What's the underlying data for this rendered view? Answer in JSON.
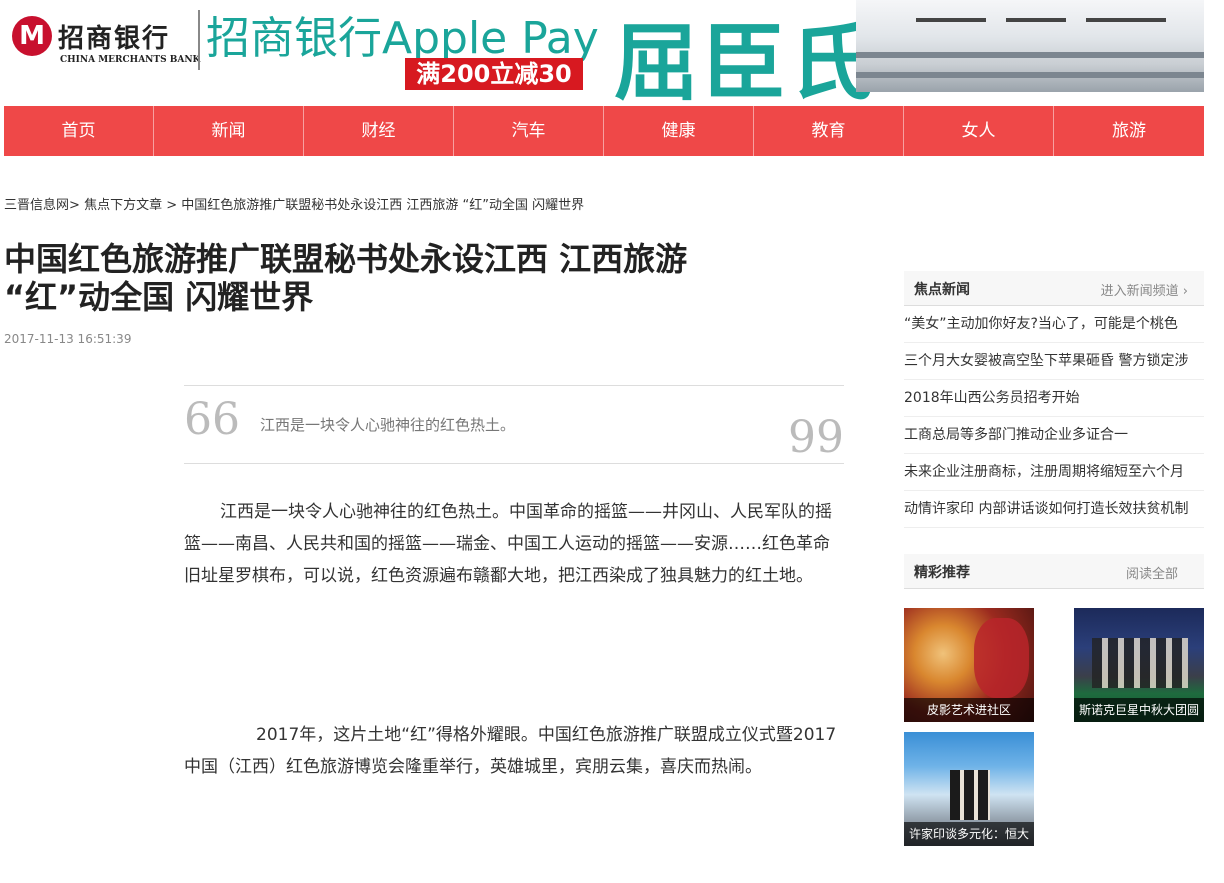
{
  "banner": {
    "bank_logo_cn": "招商银行",
    "bank_logo_en": "CHINA MERCHANTS BANK",
    "ad_text": "招商银行Apple Pay",
    "ad_promo": "满200立减30",
    "ad_brand": "屈臣氏"
  },
  "nav": {
    "items": [
      "首页",
      "新闻",
      "财经",
      "汽车",
      "健康",
      "教育",
      "女人",
      "旅游"
    ]
  },
  "breadcrumb": {
    "home": "三晋信息网",
    "sep1": ">",
    "category": "焦点下方文章",
    "sep2": ">",
    "current": "中国红色旅游推广联盟秘书处永设江西 江西旅游 “红”动全国 闪耀世界"
  },
  "article": {
    "title": "中国红色旅游推广联盟秘书处永设江西 江西旅游 “红”动全国 闪耀世界",
    "date": "2017-11-13 16:51:39",
    "quote_open": "66",
    "quote_close": "99",
    "quote": "江西是一块令人心驰神往的红色热土。",
    "paragraphs": [
      "江西是一块令人心驰神往的红色热土。中国革命的摇篮——井冈山、人民军队的摇篮——南昌、人民共和国的摇篮——瑞金、中国工人运动的摇篮——安源……红色革命旧址星罗棋布，可以说，红色资源遍布赣鄱大地，把江西染成了独具魅力的红土地。",
      "2017年，这片土地“红”得格外耀眼。中国红色旅游推广联盟成立仪式暨2017中国（江西）红色旅游博览会隆重举行，英雄城里，宾朋云集，喜庆而热闹。"
    ]
  },
  "sidebar": {
    "focus": {
      "title": "焦点新闻",
      "more": "进入新闻频道 ›",
      "items": [
        "“美女”主动加你好友?当心了，可能是个桃色",
        "三个月大女婴被高空坠下苹果砸昏 警方锁定涉",
        "2018年山西公务员招考开始",
        "工商总局等多部门推动企业多证合一",
        "未来企业注册商标，注册周期将缩短至六个月",
        "动情许家印 内部讲话谈如何打造长效扶贫机制"
      ]
    },
    "featured": {
      "title": "精彩推荐",
      "more": "阅读全部",
      "items": [
        {
          "caption": "皮影艺术进社区"
        },
        {
          "caption": "斯诺克巨星中秋大团圆"
        },
        {
          "caption": "许家印谈多元化：恒大"
        }
      ]
    }
  }
}
